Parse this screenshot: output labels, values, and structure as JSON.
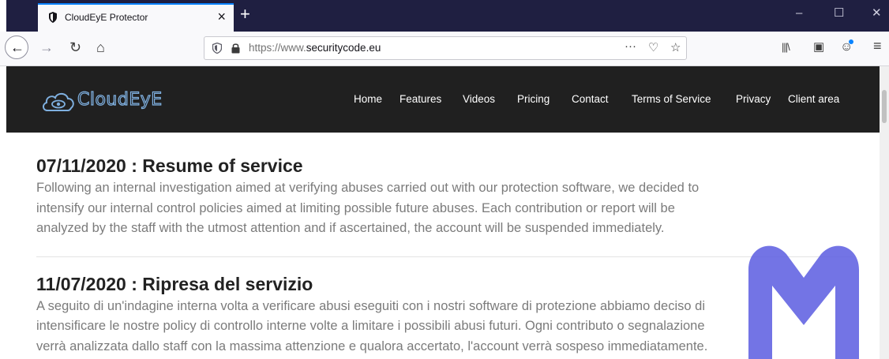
{
  "browser": {
    "tab_title": "CloudEyE Protector",
    "tab_close": "×",
    "new_tab": "+",
    "window_controls": {
      "minimize": "–",
      "maximize": "☐",
      "close": "✕"
    },
    "nav": {
      "back": "←",
      "forward": "→",
      "reload": "↻",
      "home": "⌂"
    },
    "url_prefix": "https://www.",
    "url_domain": "securitycode.eu",
    "page_actions": "···",
    "pocket": "♡",
    "star": "☆",
    "toolbar": {
      "library": "|||\\",
      "sidebar": "▣",
      "account": "☺",
      "menu": "≡"
    }
  },
  "site": {
    "logo_text": "CloudEyE",
    "menu": [
      "Home",
      "Features",
      "Videos",
      "Pricing",
      "Contact",
      "Terms of Service",
      "Privacy",
      "Client area"
    ]
  },
  "posts": [
    {
      "title": "07/11/2020 : Resume of service",
      "lines": [
        "Following an internal investigation aimed at verifying abuses carried out with our protection software, we decided to",
        "intensify our internal control policies aimed at limiting possible future abuses. Each contribution or report will be",
        "analyzed by the staff with the utmost attention and if ascertained, the account will be suspended immediately."
      ]
    },
    {
      "title": "11/07/2020 : Ripresa del servizio",
      "lines": [
        "A seguito di un'indagine interna volta a verificare abusi eseguiti con i nostri software di protezione abbiamo deciso di",
        "intensificare le nostre policy di controllo interne volte a limitare i possibili abusi futuri. Ogni contributo o segnalazione",
        "verrà analizzata dallo staff con la massima attenzione e qualora accertato, l'account verrà sospeso immediatamente."
      ]
    }
  ],
  "colors": {
    "header_bg": "#202020",
    "tabstrip_bg": "#1f1f41",
    "accent": "#0a84ff",
    "watermark": "#5a5ce0"
  }
}
